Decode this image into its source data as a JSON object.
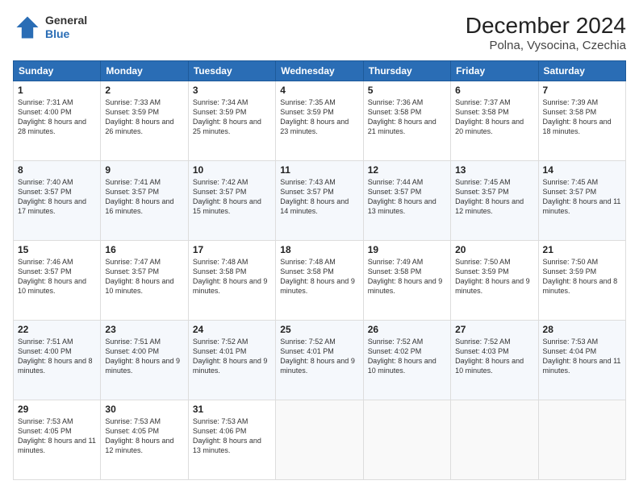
{
  "logo": {
    "general": "General",
    "blue": "Blue"
  },
  "title": "December 2024",
  "subtitle": "Polna, Vysocina, Czechia",
  "days": [
    "Sunday",
    "Monday",
    "Tuesday",
    "Wednesday",
    "Thursday",
    "Friday",
    "Saturday"
  ],
  "weeks": [
    [
      {
        "day": "1",
        "sunrise": "7:31 AM",
        "sunset": "4:00 PM",
        "daylight": "8 hours and 28 minutes."
      },
      {
        "day": "2",
        "sunrise": "7:33 AM",
        "sunset": "3:59 PM",
        "daylight": "8 hours and 26 minutes."
      },
      {
        "day": "3",
        "sunrise": "7:34 AM",
        "sunset": "3:59 PM",
        "daylight": "8 hours and 25 minutes."
      },
      {
        "day": "4",
        "sunrise": "7:35 AM",
        "sunset": "3:59 PM",
        "daylight": "8 hours and 23 minutes."
      },
      {
        "day": "5",
        "sunrise": "7:36 AM",
        "sunset": "3:58 PM",
        "daylight": "8 hours and 21 minutes."
      },
      {
        "day": "6",
        "sunrise": "7:37 AM",
        "sunset": "3:58 PM",
        "daylight": "8 hours and 20 minutes."
      },
      {
        "day": "7",
        "sunrise": "7:39 AM",
        "sunset": "3:58 PM",
        "daylight": "8 hours and 18 minutes."
      }
    ],
    [
      {
        "day": "8",
        "sunrise": "7:40 AM",
        "sunset": "3:57 PM",
        "daylight": "8 hours and 17 minutes."
      },
      {
        "day": "9",
        "sunrise": "7:41 AM",
        "sunset": "3:57 PM",
        "daylight": "8 hours and 16 minutes."
      },
      {
        "day": "10",
        "sunrise": "7:42 AM",
        "sunset": "3:57 PM",
        "daylight": "8 hours and 15 minutes."
      },
      {
        "day": "11",
        "sunrise": "7:43 AM",
        "sunset": "3:57 PM",
        "daylight": "8 hours and 14 minutes."
      },
      {
        "day": "12",
        "sunrise": "7:44 AM",
        "sunset": "3:57 PM",
        "daylight": "8 hours and 13 minutes."
      },
      {
        "day": "13",
        "sunrise": "7:45 AM",
        "sunset": "3:57 PM",
        "daylight": "8 hours and 12 minutes."
      },
      {
        "day": "14",
        "sunrise": "7:45 AM",
        "sunset": "3:57 PM",
        "daylight": "8 hours and 11 minutes."
      }
    ],
    [
      {
        "day": "15",
        "sunrise": "7:46 AM",
        "sunset": "3:57 PM",
        "daylight": "8 hours and 10 minutes."
      },
      {
        "day": "16",
        "sunrise": "7:47 AM",
        "sunset": "3:57 PM",
        "daylight": "8 hours and 10 minutes."
      },
      {
        "day": "17",
        "sunrise": "7:48 AM",
        "sunset": "3:58 PM",
        "daylight": "8 hours and 9 minutes."
      },
      {
        "day": "18",
        "sunrise": "7:48 AM",
        "sunset": "3:58 PM",
        "daylight": "8 hours and 9 minutes."
      },
      {
        "day": "19",
        "sunrise": "7:49 AM",
        "sunset": "3:58 PM",
        "daylight": "8 hours and 9 minutes."
      },
      {
        "day": "20",
        "sunrise": "7:50 AM",
        "sunset": "3:59 PM",
        "daylight": "8 hours and 9 minutes."
      },
      {
        "day": "21",
        "sunrise": "7:50 AM",
        "sunset": "3:59 PM",
        "daylight": "8 hours and 8 minutes."
      }
    ],
    [
      {
        "day": "22",
        "sunrise": "7:51 AM",
        "sunset": "4:00 PM",
        "daylight": "8 hours and 8 minutes."
      },
      {
        "day": "23",
        "sunrise": "7:51 AM",
        "sunset": "4:00 PM",
        "daylight": "8 hours and 9 minutes."
      },
      {
        "day": "24",
        "sunrise": "7:52 AM",
        "sunset": "4:01 PM",
        "daylight": "8 hours and 9 minutes."
      },
      {
        "day": "25",
        "sunrise": "7:52 AM",
        "sunset": "4:01 PM",
        "daylight": "8 hours and 9 minutes."
      },
      {
        "day": "26",
        "sunrise": "7:52 AM",
        "sunset": "4:02 PM",
        "daylight": "8 hours and 10 minutes."
      },
      {
        "day": "27",
        "sunrise": "7:52 AM",
        "sunset": "4:03 PM",
        "daylight": "8 hours and 10 minutes."
      },
      {
        "day": "28",
        "sunrise": "7:53 AM",
        "sunset": "4:04 PM",
        "daylight": "8 hours and 11 minutes."
      }
    ],
    [
      {
        "day": "29",
        "sunrise": "7:53 AM",
        "sunset": "4:05 PM",
        "daylight": "8 hours and 11 minutes."
      },
      {
        "day": "30",
        "sunrise": "7:53 AM",
        "sunset": "4:05 PM",
        "daylight": "8 hours and 12 minutes."
      },
      {
        "day": "31",
        "sunrise": "7:53 AM",
        "sunset": "4:06 PM",
        "daylight": "8 hours and 13 minutes."
      },
      null,
      null,
      null,
      null
    ]
  ]
}
